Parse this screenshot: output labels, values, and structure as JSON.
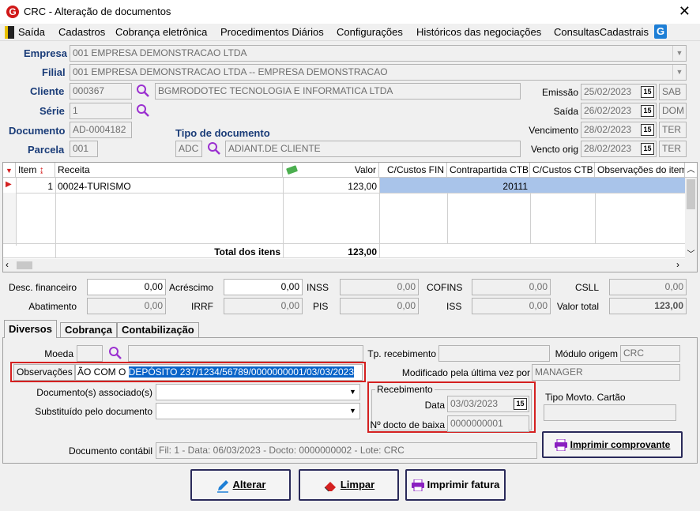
{
  "window": {
    "title": "CRC - Alteração de documentos",
    "close": "✕"
  },
  "menu": [
    "Saída",
    "Cadastros",
    "Cobrança eletrônica",
    "Procedimentos Diários",
    "Configurações",
    "Históricos das negociações",
    "ConsultasCadastrais"
  ],
  "header": {
    "empresa_label": "Empresa",
    "empresa_value": "001 EMPRESA DEMONSTRACAO LTDA",
    "filial_label": "Filial",
    "filial_value": "001 EMPRESA DEMONSTRACAO LTDA -- EMPRESA DEMONSTRACAO",
    "cliente_label": "Cliente",
    "cliente_code": "000367",
    "cliente_name": "BGMRODOTEC TECNOLOGIA E INFORMATICA LTDA",
    "serie_label": "Série",
    "serie_value": "1",
    "documento_label": "Documento",
    "documento_value": "AD-0004182",
    "tipo_doc_label": "Tipo de documento",
    "tipo_doc_code": "ADC",
    "tipo_doc_name": "ADIANT.DE CLIENTE",
    "parcela_label": "Parcela",
    "parcela_value": "001",
    "emissao_label": "Emissão",
    "emissao_value": "25/02/2023",
    "emissao_day": "SAB",
    "saida_label": "Saída",
    "saida_value": "26/02/2023",
    "saida_day": "DOM",
    "vencimento_label": "Vencimento",
    "vencimento_value": "28/02/2023",
    "vencimento_day": "TER",
    "vencto_orig_label": "Vencto orig",
    "vencto_orig_value": "28/02/2023",
    "vencto_orig_day": "TER",
    "cal_icon_text": "15"
  },
  "grid": {
    "columns": [
      "Item",
      "Receita",
      "",
      "Valor",
      "C/Custos FIN",
      "Contrapartida CTB",
      "C/Custos CTB",
      "Observações do item"
    ],
    "rows": [
      {
        "item": "1",
        "receita": "00024-TURISMO",
        "valor": "123,00",
        "ccfin": "",
        "contrapartida": "20111",
        "ccctb": "",
        "obs": ""
      }
    ],
    "total_label": "Total dos itens",
    "total_value": "123,00"
  },
  "totals": {
    "desc_fin_label": "Desc. financeiro",
    "desc_fin": "0,00",
    "acrescimo_label": "Acréscimo",
    "acrescimo": "0,00",
    "inss_label": "INSS",
    "inss": "0,00",
    "cofins_label": "COFINS",
    "cofins": "0,00",
    "csll_label": "CSLL",
    "csll": "0,00",
    "abatimento_label": "Abatimento",
    "abatimento": "0,00",
    "irrf_label": "IRRF",
    "irrf": "0,00",
    "pis_label": "PIS",
    "pis": "0,00",
    "iss_label": "ISS",
    "iss": "0,00",
    "valor_total_label": "Valor total",
    "valor_total": "123,00"
  },
  "tabs": [
    "Diversos",
    "Cobrança",
    "Contabilização"
  ],
  "diversos": {
    "moeda_label": "Moeda",
    "tp_recebimento_label": "Tp. recebimento",
    "modulo_origem_label": "Módulo origem",
    "modulo_origem": "CRC",
    "observacoes_label": "Observações",
    "observacoes_prefix": "ÃO COM O ",
    "observacoes_selected": "DEPÓSITO 237/1234/56789/0000000001/03/03/2023",
    "modificado_label": "Modificado pela última vez por",
    "modificado_value": "MANAGER",
    "doc_associados_label": "Documento(s) associado(s)",
    "substituido_label": "Substituído pelo documento",
    "recebimento_group": "Recebimento",
    "data_label": "Data",
    "data_value": "03/03/2023",
    "docto_baixa_label": "Nº docto de baixa",
    "docto_baixa_value": "0000000001",
    "tipo_movto_label": "Tipo Movto. Cartão",
    "doc_contabil_label": "Documento contábil",
    "doc_contabil_value": "Fil: 1 - Data: 06/03/2023 - Docto: 0000000002 - Lote: CRC",
    "imprimir_comprovante": "Imprimir comprovante"
  },
  "buttons": {
    "alterar": "Alterar",
    "limpar": "Limpar",
    "imprimir_fatura": "Imprimir fatura"
  },
  "colors": {
    "accent_red": "#d42020",
    "label_blue": "#1a3c78",
    "selection": "#0a64c8"
  }
}
